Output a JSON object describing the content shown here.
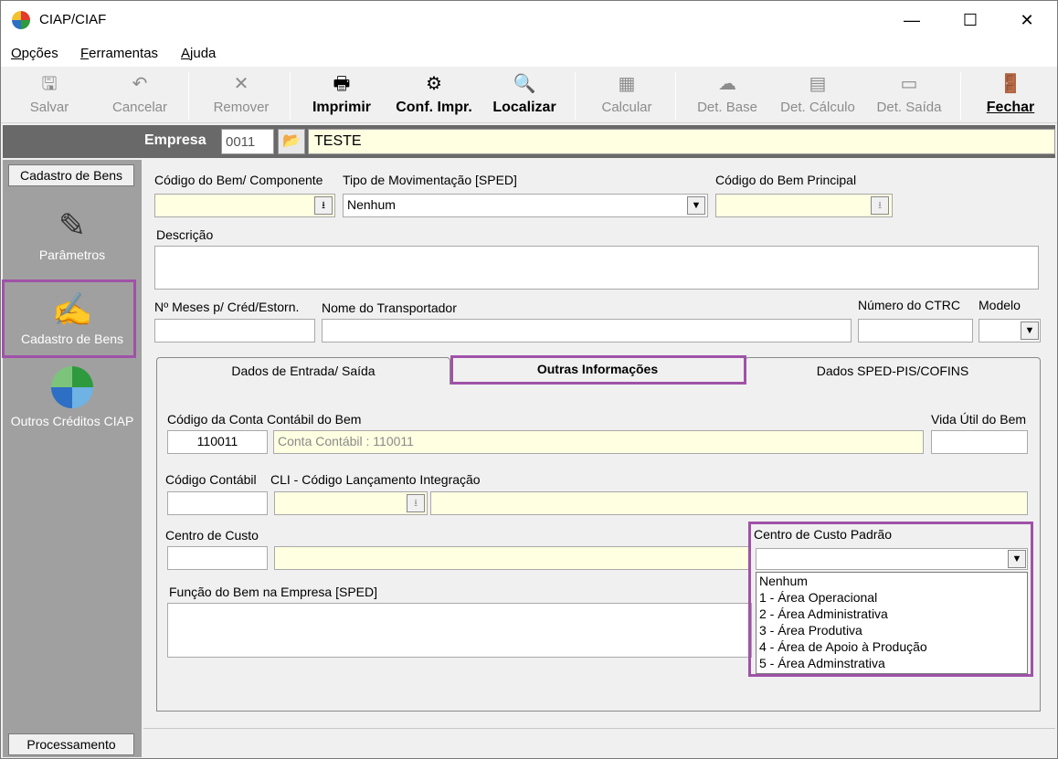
{
  "window": {
    "title": "CIAP/CIAF",
    "min": "—",
    "max": "☐",
    "close": "✕"
  },
  "menu": [
    {
      "underline": "O",
      "rest": "pções"
    },
    {
      "underline": "F",
      "rest": "erramentas"
    },
    {
      "underline": "A",
      "rest": "juda"
    }
  ],
  "toolbar": {
    "salvar": "Salvar",
    "cancelar": "Cancelar",
    "remover": "Remover",
    "imprimir": "Imprimir",
    "conf_impr": "Conf. Impr.",
    "localizar": "Localizar",
    "calcular": "Calcular",
    "det_base": "Det. Base",
    "det_calculo": "Det. Cálculo",
    "det_saida": "Det. Saída",
    "fechar": "Fechar"
  },
  "empresa": {
    "label": "Empresa",
    "code": "0011",
    "name": "TESTE"
  },
  "sidebar": {
    "header": "Cadastro de Bens",
    "items": [
      {
        "label": "Parâmetros",
        "icon": "parameters-icon"
      },
      {
        "label": "Cadastro de Bens",
        "icon": "asset-register-icon"
      },
      {
        "label": "Outros Créditos CIAP",
        "icon": "other-credits-icon"
      }
    ],
    "footer": "Processamento"
  },
  "form": {
    "codigo_bem_label": "Código do Bem/ Componente",
    "tipo_mov_label": "Tipo de Movimentação [SPED]",
    "tipo_mov_value": "Nenhum",
    "codigo_principal_label": "Código do Bem Principal",
    "descricao_label": "Descrição",
    "meses_label": "Nº Meses p/ Créd/Estorn.",
    "transportador_label": "Nome do Transportador",
    "ctrc_label": "Número do CTRC",
    "modelo_label": "Modelo"
  },
  "tabs": [
    {
      "label": "Dados de Entrada/ Saída"
    },
    {
      "label": "Outras Informações"
    },
    {
      "label": "Dados SPED-PIS/COFINS"
    }
  ],
  "outras": {
    "conta_contabil_label": "Código da Conta Contábil do Bem",
    "conta_code": "110011",
    "conta_desc": "Conta Contábil : 110011",
    "vida_util_label": "Vida Útil do Bem",
    "codigo_contabil_label": "Código Contábil",
    "cli_label": "CLI - Código Lançamento Integração",
    "centro_custo_label": "Centro de Custo",
    "centro_padrao_label": "Centro de Custo Padrão",
    "funcao_label": "Função do Bem na Empresa [SPED]",
    "centro_options": [
      "Nenhum",
      "1 - Área Operacional",
      "2 - Área Administrativa",
      "3 - Área Produtiva",
      "4 - Área de Apoio à Produção",
      "5 - Área Adminstrativa"
    ]
  },
  "colors": {
    "highlight": "#a052a8",
    "yellow_field": "#ffffe1",
    "sidebar": "#a0a0a0"
  }
}
